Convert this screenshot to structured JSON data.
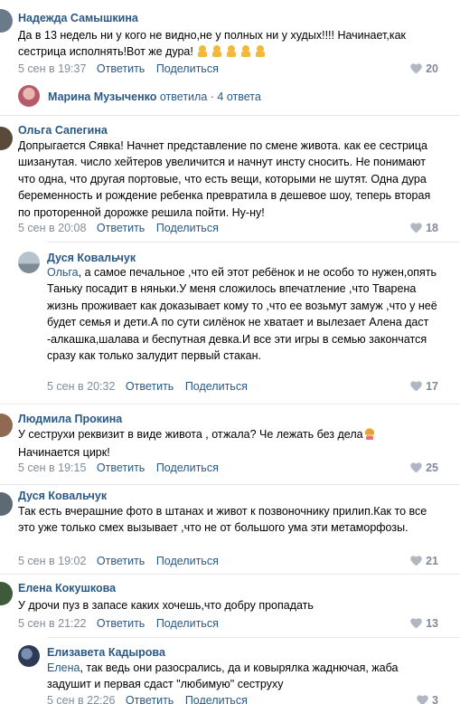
{
  "comments": [
    {
      "author": "Надежда Самышкина",
      "text": "Да в 13 недель ни у кого не видно,не у полных ни у худых!!!! Начинает,как сестрица исполнять!Вот же дура!",
      "emoji_count": 5,
      "date": "5 сен в 19:37",
      "reply": "Ответить",
      "share": "Поделиться",
      "likes": "20"
    },
    {
      "author": "Ольга Сапегина",
      "text": "Допрыгается Сявка! Начнет представление по смене живота. как ее сестрица шизанутая. число хейтеров увеличится и начнут инсту сносить. Не понимают что одна, что другая портовые, что есть вещи, которыми не шутят. Одна дура беременность и рождение ребенка превратила в дешевое шоу, теперь вторая по проторенной дорожке решила пойти. Ну-ну!",
      "date": "5 сен в 20:08",
      "reply": "Ответить",
      "share": "Поделиться",
      "likes": "18"
    },
    {
      "author": "Дуся Ковальчук",
      "reply_to": "Ольга",
      "text": ", а самое печальное ,что ей этот ребёнок и не особо то нужен,опять Таньку посадит в няньки.У меня сложилось впечатление ,что Тварена жизнь проживает как доказывает кому то ,что ее возьмут замуж ,что у неё будет семья и дети.А по сути силёнок не хватает и вылезает Алена даст -алкашка,шалава и беспутная девка.И все эти игры в семью закончатся сразу как только залудит первый стакан.",
      "date": "5 сен в 20:32",
      "reply": "Ответить",
      "share": "Поделиться",
      "likes": "17"
    },
    {
      "author": "Людмила Прокина",
      "text": "У сеструхи реквизит в виде живота , отжала? Че лежать без дела",
      "text2": "Начинается цирк!",
      "date": "5 сен в 19:15",
      "reply": "Ответить",
      "share": "Поделиться",
      "likes": "25"
    },
    {
      "author": "Дуся Ковальчук",
      "text": "Так есть вчерашние фото в штанах и живот к позвоночнику прилип.Как то все это уже только смех вызывает ,что не от большого ума эти метаморфозы.",
      "date": "5 сен в 19:02",
      "reply": "Ответить",
      "share": "Поделиться",
      "likes": "21"
    },
    {
      "author": "Елена Кокушкова",
      "text": "У дрочи пуз в запасе каких хочешь,что добру пропадать",
      "date": "5 сен в 21:22",
      "reply": "Ответить",
      "share": "Поделиться",
      "likes": "13"
    },
    {
      "author": "Елизавета Кадырова",
      "reply_to": "Елена",
      "text": ", так ведь они разосрались, да и ковырялка жаднючая, жаба задушит и первая сдаст \"любимую\" сеструху",
      "date": "5 сен в 22:26",
      "reply": "Ответить",
      "share": "Поделиться",
      "likes": "3"
    }
  ],
  "thread": {
    "author": "Марина Музыченко",
    "action": "ответила",
    "separator": "·",
    "count": "4 ответа"
  },
  "colors": {
    "link": "#2a5885",
    "meta": "#818c99",
    "divider": "#e7e8ec",
    "likes": "#828a99"
  }
}
